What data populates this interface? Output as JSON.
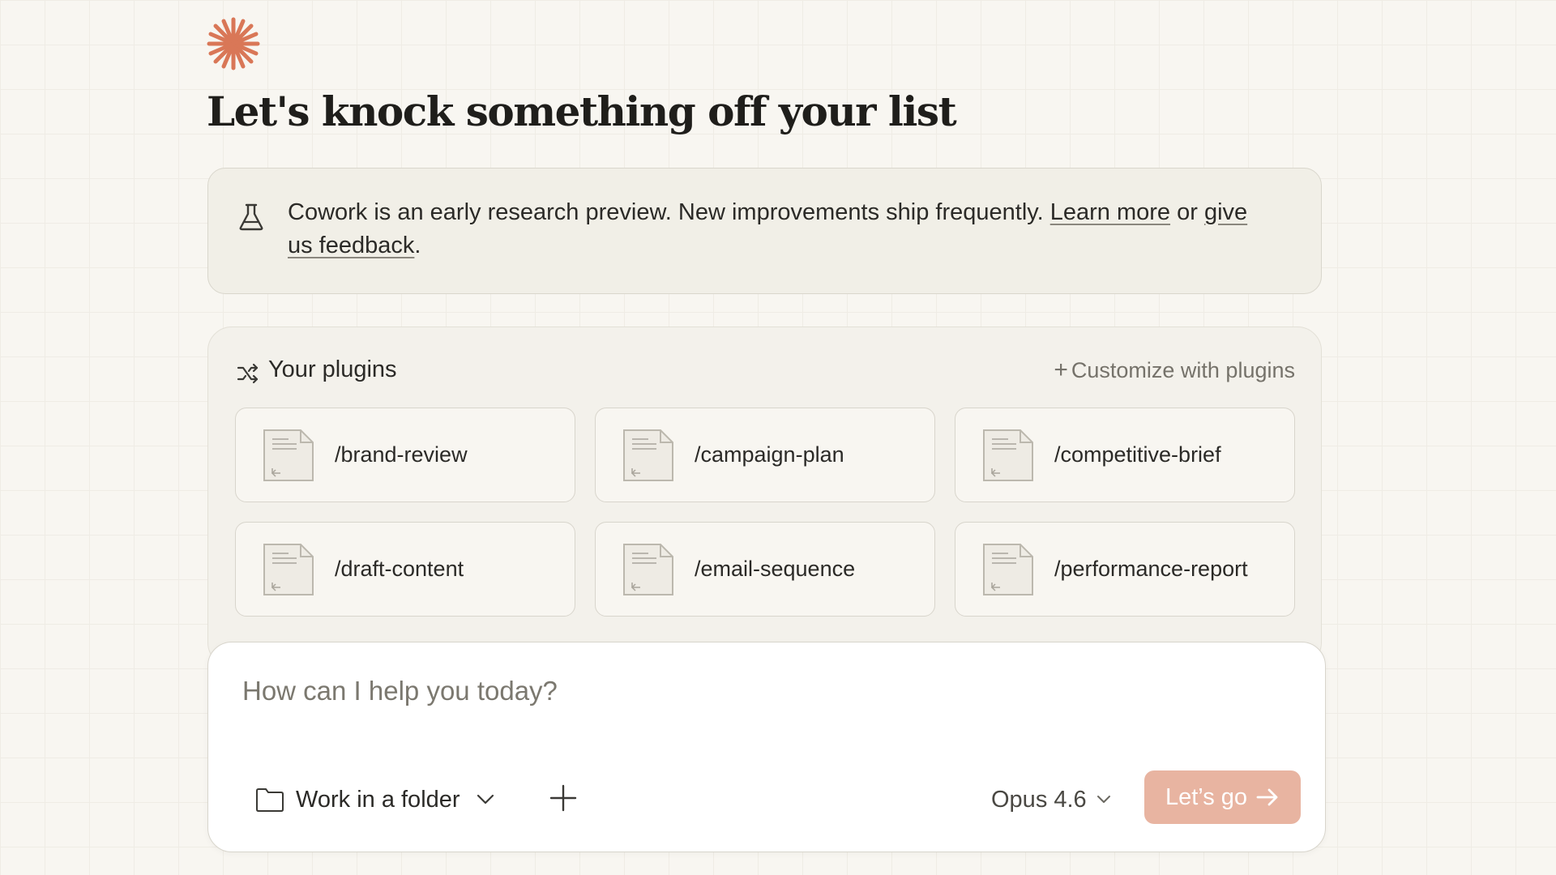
{
  "colors": {
    "accent": "#d97757",
    "background": "#f8f6f1",
    "notice_bg": "#f1efe7",
    "primary_button": "#e8b4a1",
    "text": "#2b2a27",
    "muted": "#75726a"
  },
  "logo": {
    "icon": "starburst-logo-icon"
  },
  "heading": "Let's knock something off your list",
  "notice": {
    "icon": "flask-icon",
    "text_before": "Cowork is an early research preview. New improvements ship frequently. ",
    "learn_more": "Learn more",
    "or": " or ",
    "feedback": "give us feedback",
    "period": "."
  },
  "plugins": {
    "icon": "shuffle-icon",
    "title": "Your plugins",
    "customize_label": "Customize with plugins",
    "items": [
      {
        "label": "/brand-review",
        "icon": "document-icon"
      },
      {
        "label": "/campaign-plan",
        "icon": "document-icon"
      },
      {
        "label": "/competitive-brief",
        "icon": "document-icon"
      },
      {
        "label": "/draft-content",
        "icon": "document-icon"
      },
      {
        "label": "/email-sequence",
        "icon": "document-icon"
      },
      {
        "label": "/performance-report",
        "icon": "document-icon"
      }
    ]
  },
  "composer": {
    "placeholder": "How can I help you today?",
    "value": "",
    "folder_label": "Work in a folder",
    "model_label": "Opus 4.6",
    "submit_label": "Let’s go"
  }
}
